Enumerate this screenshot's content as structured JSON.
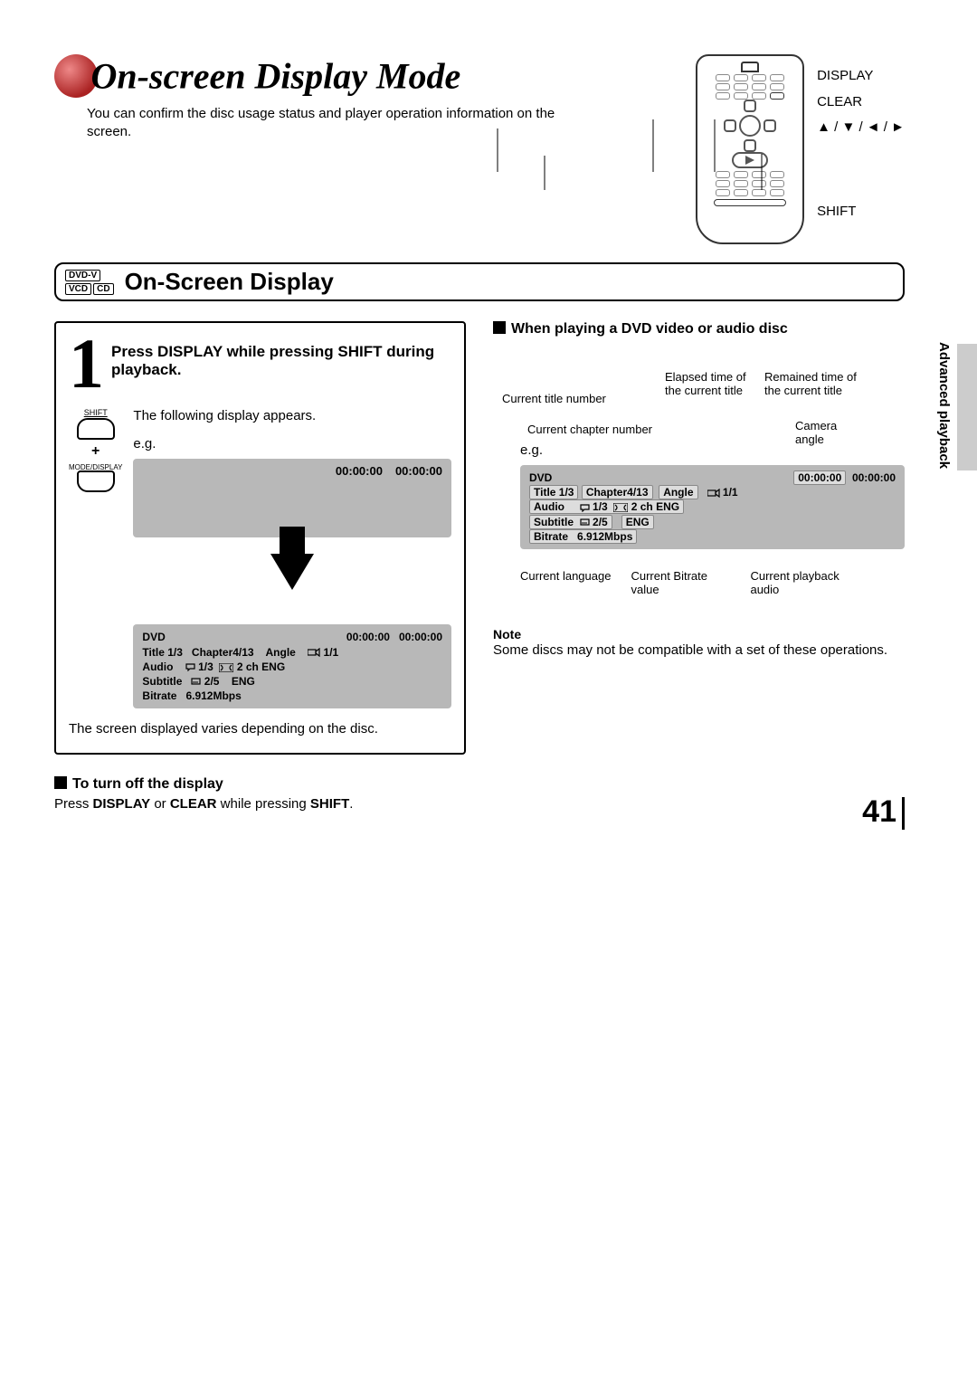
{
  "header": {
    "title": "On-screen Display Mode",
    "subtitle": "You can confirm the disc usage status and player operation information on the screen."
  },
  "remote_labels": {
    "display": "DISPLAY",
    "clear": "CLEAR",
    "arrows": "▲ / ▼ / ◄ / ►",
    "shift": "SHIFT"
  },
  "section": {
    "tags": {
      "dvdv": "DVD-V",
      "vcd": "VCD",
      "cd": "CD"
    },
    "title": "On-Screen Display"
  },
  "step1": {
    "num": "1",
    "heading": "Press DISPLAY while pressing SHIFT during playback.",
    "shift_label": "SHIFT",
    "mode_label": "MODE/DISPLAY",
    "following": "The following display appears.",
    "eg": "e.g.",
    "initial_times": {
      "a": "00:00:00",
      "b": "00:00:00"
    },
    "footer": "The screen displayed varies depending on the disc."
  },
  "osd": {
    "disc": "DVD",
    "elapsed": "00:00:00",
    "remaining": "00:00:00",
    "title": "Title 1/3",
    "chapter": "Chapter4/13",
    "angle_label": "Angle",
    "angle_val": "1/1",
    "audio_label": "Audio",
    "audio_val": "1/3",
    "audio_desc": "2 ch ENG",
    "subtitle_label": "Subtitle",
    "subtitle_val": "2/5",
    "subtitle_lang": "ENG",
    "bitrate_label": "Bitrate",
    "bitrate_val": "6.912Mbps"
  },
  "turn_off": {
    "heading": "To turn off the display",
    "body_pre": "Press ",
    "body_b1": "DISPLAY",
    "body_mid": " or ",
    "body_b2": "CLEAR",
    "body_mid2": " while pressing ",
    "body_b3": "SHIFT",
    "body_end": "."
  },
  "right": {
    "heading": "When playing a DVD video or audio disc",
    "eg": "e.g.",
    "callouts": {
      "title_num": "Current title number",
      "chapter_num": "Current chapter number",
      "elapsed": "Elapsed time of the current title",
      "remaining": "Remained time of the current title",
      "angle": "Camera angle",
      "language": "Current language",
      "bitrate": "Current Bitrate value",
      "playback_audio": "Current playback audio"
    },
    "note_head": "Note",
    "note_body": "Some discs may not be compatible with a set of these operations."
  },
  "side_text": "Advanced playback",
  "page_number": "41"
}
